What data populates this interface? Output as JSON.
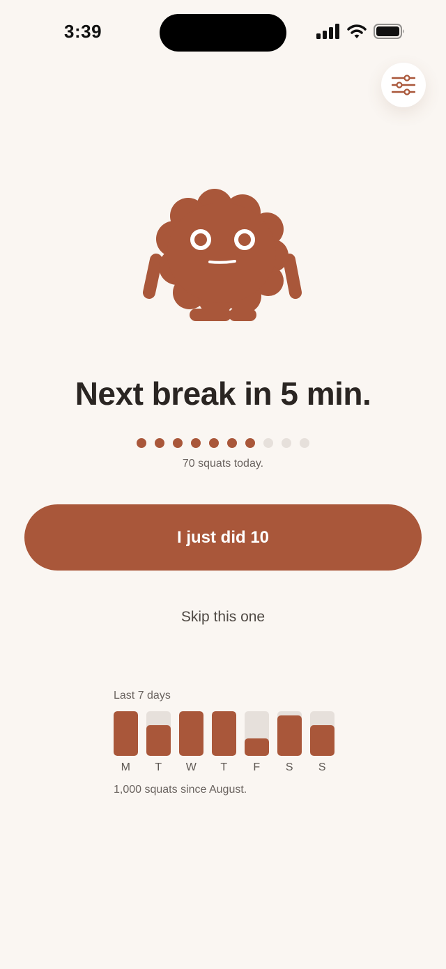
{
  "status_bar": {
    "time": "3:39",
    "icons": [
      "cellular-signal-icon",
      "wifi-icon",
      "battery-icon"
    ]
  },
  "settings": {
    "icon": "sliders-icon"
  },
  "headline": "Next break in 5 min.",
  "progress": {
    "filled": 7,
    "total": 10
  },
  "today_count": "70 squats today.",
  "primary_button": "I just did 10",
  "skip_link": "Skip this one",
  "week": {
    "title": "Last 7 days",
    "days": [
      {
        "label": "M",
        "fraction": 1.0
      },
      {
        "label": "T",
        "fraction": 0.69
      },
      {
        "label": "W",
        "fraction": 1.0
      },
      {
        "label": "T",
        "fraction": 1.0
      },
      {
        "label": "F",
        "fraction": 0.39
      },
      {
        "label": "S",
        "fraction": 0.91
      },
      {
        "label": "S",
        "fraction": 0.69
      }
    ],
    "summary": "1,000 squats since August."
  },
  "colors": {
    "accent": "#a9573a",
    "track": "#e6e0db",
    "background": "#faf6f2",
    "text": "#2a2522"
  }
}
